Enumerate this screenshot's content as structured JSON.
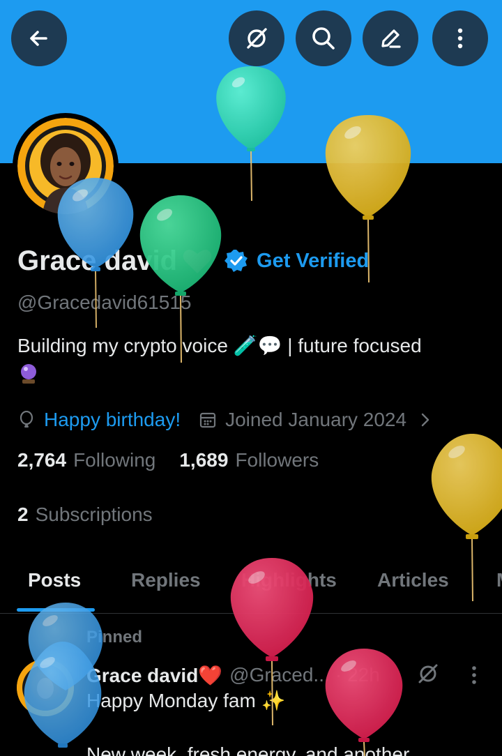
{
  "colors": {
    "banner": "#1d9bf0",
    "accent": "#1d9bf0",
    "background": "#000000",
    "text_primary": "#e7e9ea",
    "text_secondary": "#71767b"
  },
  "topbar": {
    "back_icon": "arrow-left-icon",
    "buttons": [
      "grok-icon",
      "search-icon",
      "edit-icon",
      "more-vertical-icon"
    ]
  },
  "profile": {
    "name": "Grace david",
    "name_emoji": "red-heart-icon",
    "get_verified": "Get Verified",
    "handle": "@Gracedavid61515",
    "bio": "Building my crypto voice 🧪💬 | future focused",
    "bio_line2_emoji": "crystal-ball-icon",
    "birthday": "Happy birthday!",
    "joined": "Joined January 2024",
    "following_count": "2,764",
    "following_label": "Following",
    "followers_count": "1,689",
    "followers_label": "Followers",
    "subscriptions_count": "2",
    "subscriptions_label": "Subscriptions"
  },
  "tabs": [
    {
      "label": "Posts",
      "active": true
    },
    {
      "label": "Replies",
      "active": false
    },
    {
      "label": "Highlights",
      "active": false
    },
    {
      "label": "Articles",
      "active": false
    },
    {
      "label": "M",
      "active": false
    }
  ],
  "post": {
    "pinned_label": "Pinned",
    "author_name": "Grace david❤️",
    "author_handle": "@Graced...",
    "dot": "·",
    "time": "22h",
    "line1": "Happy Monday fam ✨",
    "line2": "New week, fresh energy, and another"
  }
}
